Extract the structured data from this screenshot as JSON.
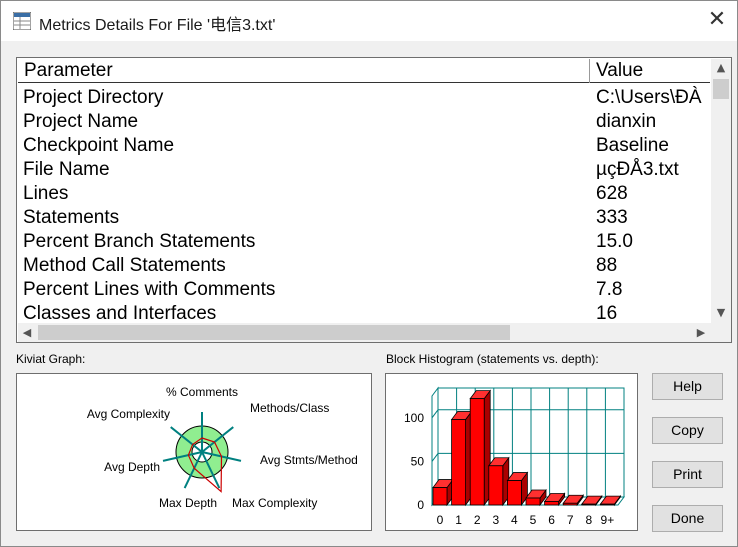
{
  "window": {
    "title": "Metrics Details For File '电信3.txt'",
    "close_glyph": "✕",
    "app_icon": "grid-icon"
  },
  "table": {
    "headers": {
      "parameter": "Parameter",
      "value": "Value"
    },
    "rows": [
      {
        "parameter": "Project Directory",
        "value": "C:\\Users\\ĐÀ"
      },
      {
        "parameter": "Project Name",
        "value": "dianxin"
      },
      {
        "parameter": "Checkpoint Name",
        "value": "Baseline"
      },
      {
        "parameter": "File Name",
        "value": "µçĐÅ3.txt"
      },
      {
        "parameter": "Lines",
        "value": "628"
      },
      {
        "parameter": "Statements",
        "value": "333"
      },
      {
        "parameter": "Percent Branch Statements",
        "value": "15.0"
      },
      {
        "parameter": "Method Call Statements",
        "value": "88"
      },
      {
        "parameter": "Percent Lines with Comments",
        "value": "7.8"
      },
      {
        "parameter": "Classes and Interfaces",
        "value": "16"
      }
    ],
    "scroll_up_glyph": "▲",
    "scroll_down_glyph": "▼",
    "scroll_left_glyph": "◀",
    "scroll_right_glyph": "▶"
  },
  "kiviat": {
    "label": "Kiviat Graph:",
    "axes": [
      "% Comments",
      "Methods/Class",
      "Avg Stmts/Method",
      "Max Complexity",
      "Max Depth",
      "Avg Depth",
      "Avg Complexity"
    ],
    "colors": {
      "ring": "#90ee90",
      "axis": "#008080",
      "plot": "#cc0000"
    }
  },
  "histogram": {
    "label": "Block Histogram (statements vs. depth):",
    "chart_data": {
      "type": "bar",
      "categories": [
        "0",
        "1",
        "2",
        "3",
        "4",
        "5",
        "6",
        "7",
        "8",
        "9+"
      ],
      "values": [
        20,
        98,
        122,
        45,
        28,
        8,
        4,
        2,
        1,
        1
      ],
      "y_ticks": [
        "0",
        "50",
        "100"
      ],
      "ylim": [
        0,
        125
      ],
      "bar_color": "#ff0000",
      "grid_color": "#008080"
    }
  },
  "buttons": {
    "help": "Help",
    "copy": "Copy",
    "print": "Print",
    "done": "Done"
  }
}
